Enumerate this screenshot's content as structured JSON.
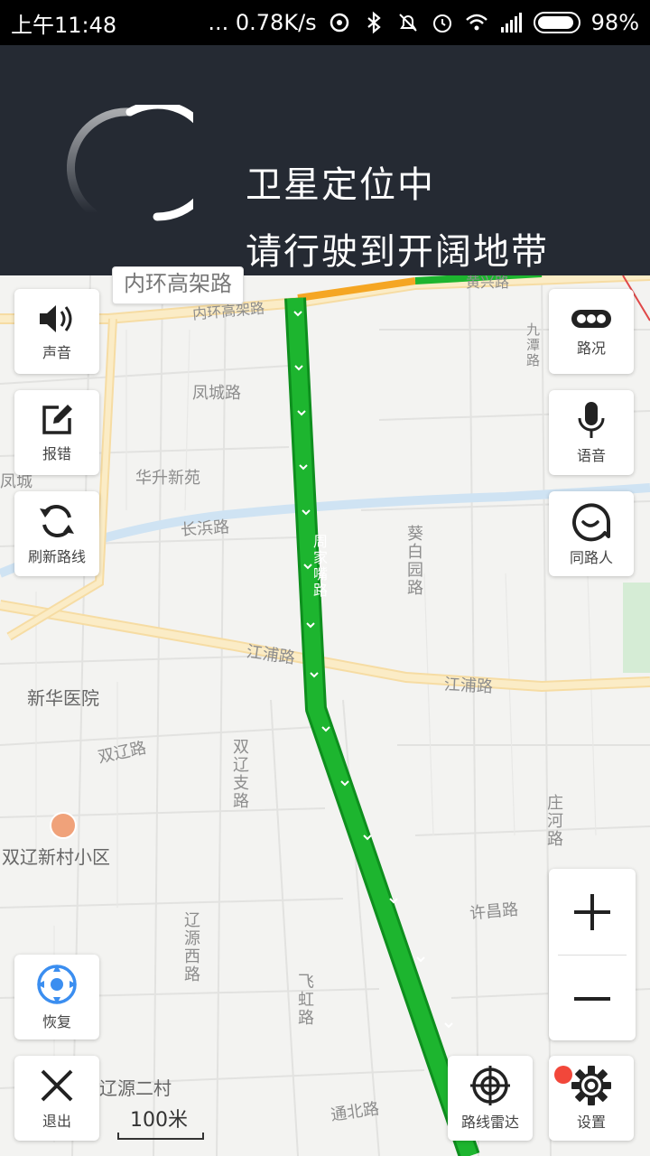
{
  "status_bar": {
    "time": "上午11:48",
    "network_speed": "... 0.78K/s",
    "battery": "98%"
  },
  "gps_banner": {
    "title": "卫星定位中",
    "subtitle": "请行驶到开阔地带"
  },
  "map": {
    "road_tooltip": "内环高架路",
    "labels": {
      "neihuan": "内环高架路",
      "fengcheng": "凤城路",
      "huangxing": "黄兴路",
      "jiutan": "九潭路",
      "huasheng": "华升新苑",
      "fengcheng2": "凤城",
      "changbin": "长浜路",
      "zhoujiazui": "周家嘴路",
      "kuibaiyuan": "葵白园路",
      "jiangpu1": "江浦路",
      "jiangpu2": "江浦路",
      "xinhua": "新华医院",
      "shuangliao": "双辽路",
      "shuangliaozhi": "双辽支路",
      "zhuanghe": "庄河路",
      "shuangliaoxincun": "双辽新村小区",
      "xuchang": "许昌路",
      "liaoyuanxi": "辽源西路",
      "feihong": "飞虹路",
      "liaoyuan2": "辽源二村",
      "tongbei": "通北路"
    },
    "scale": "100米"
  },
  "controls": {
    "sound": "声音",
    "report_error": "报错",
    "refresh_route": "刷新路线",
    "traffic": "路况",
    "voice": "语音",
    "fellow_travelers": "同路人",
    "restore": "恢复",
    "exit": "退出",
    "route_radar": "路线雷达",
    "settings": "设置"
  },
  "colors": {
    "banner_bg": "#252a33",
    "route_green": "#1db52f",
    "restore_blue": "#3b8ef0",
    "badge_red": "#f2473a"
  }
}
